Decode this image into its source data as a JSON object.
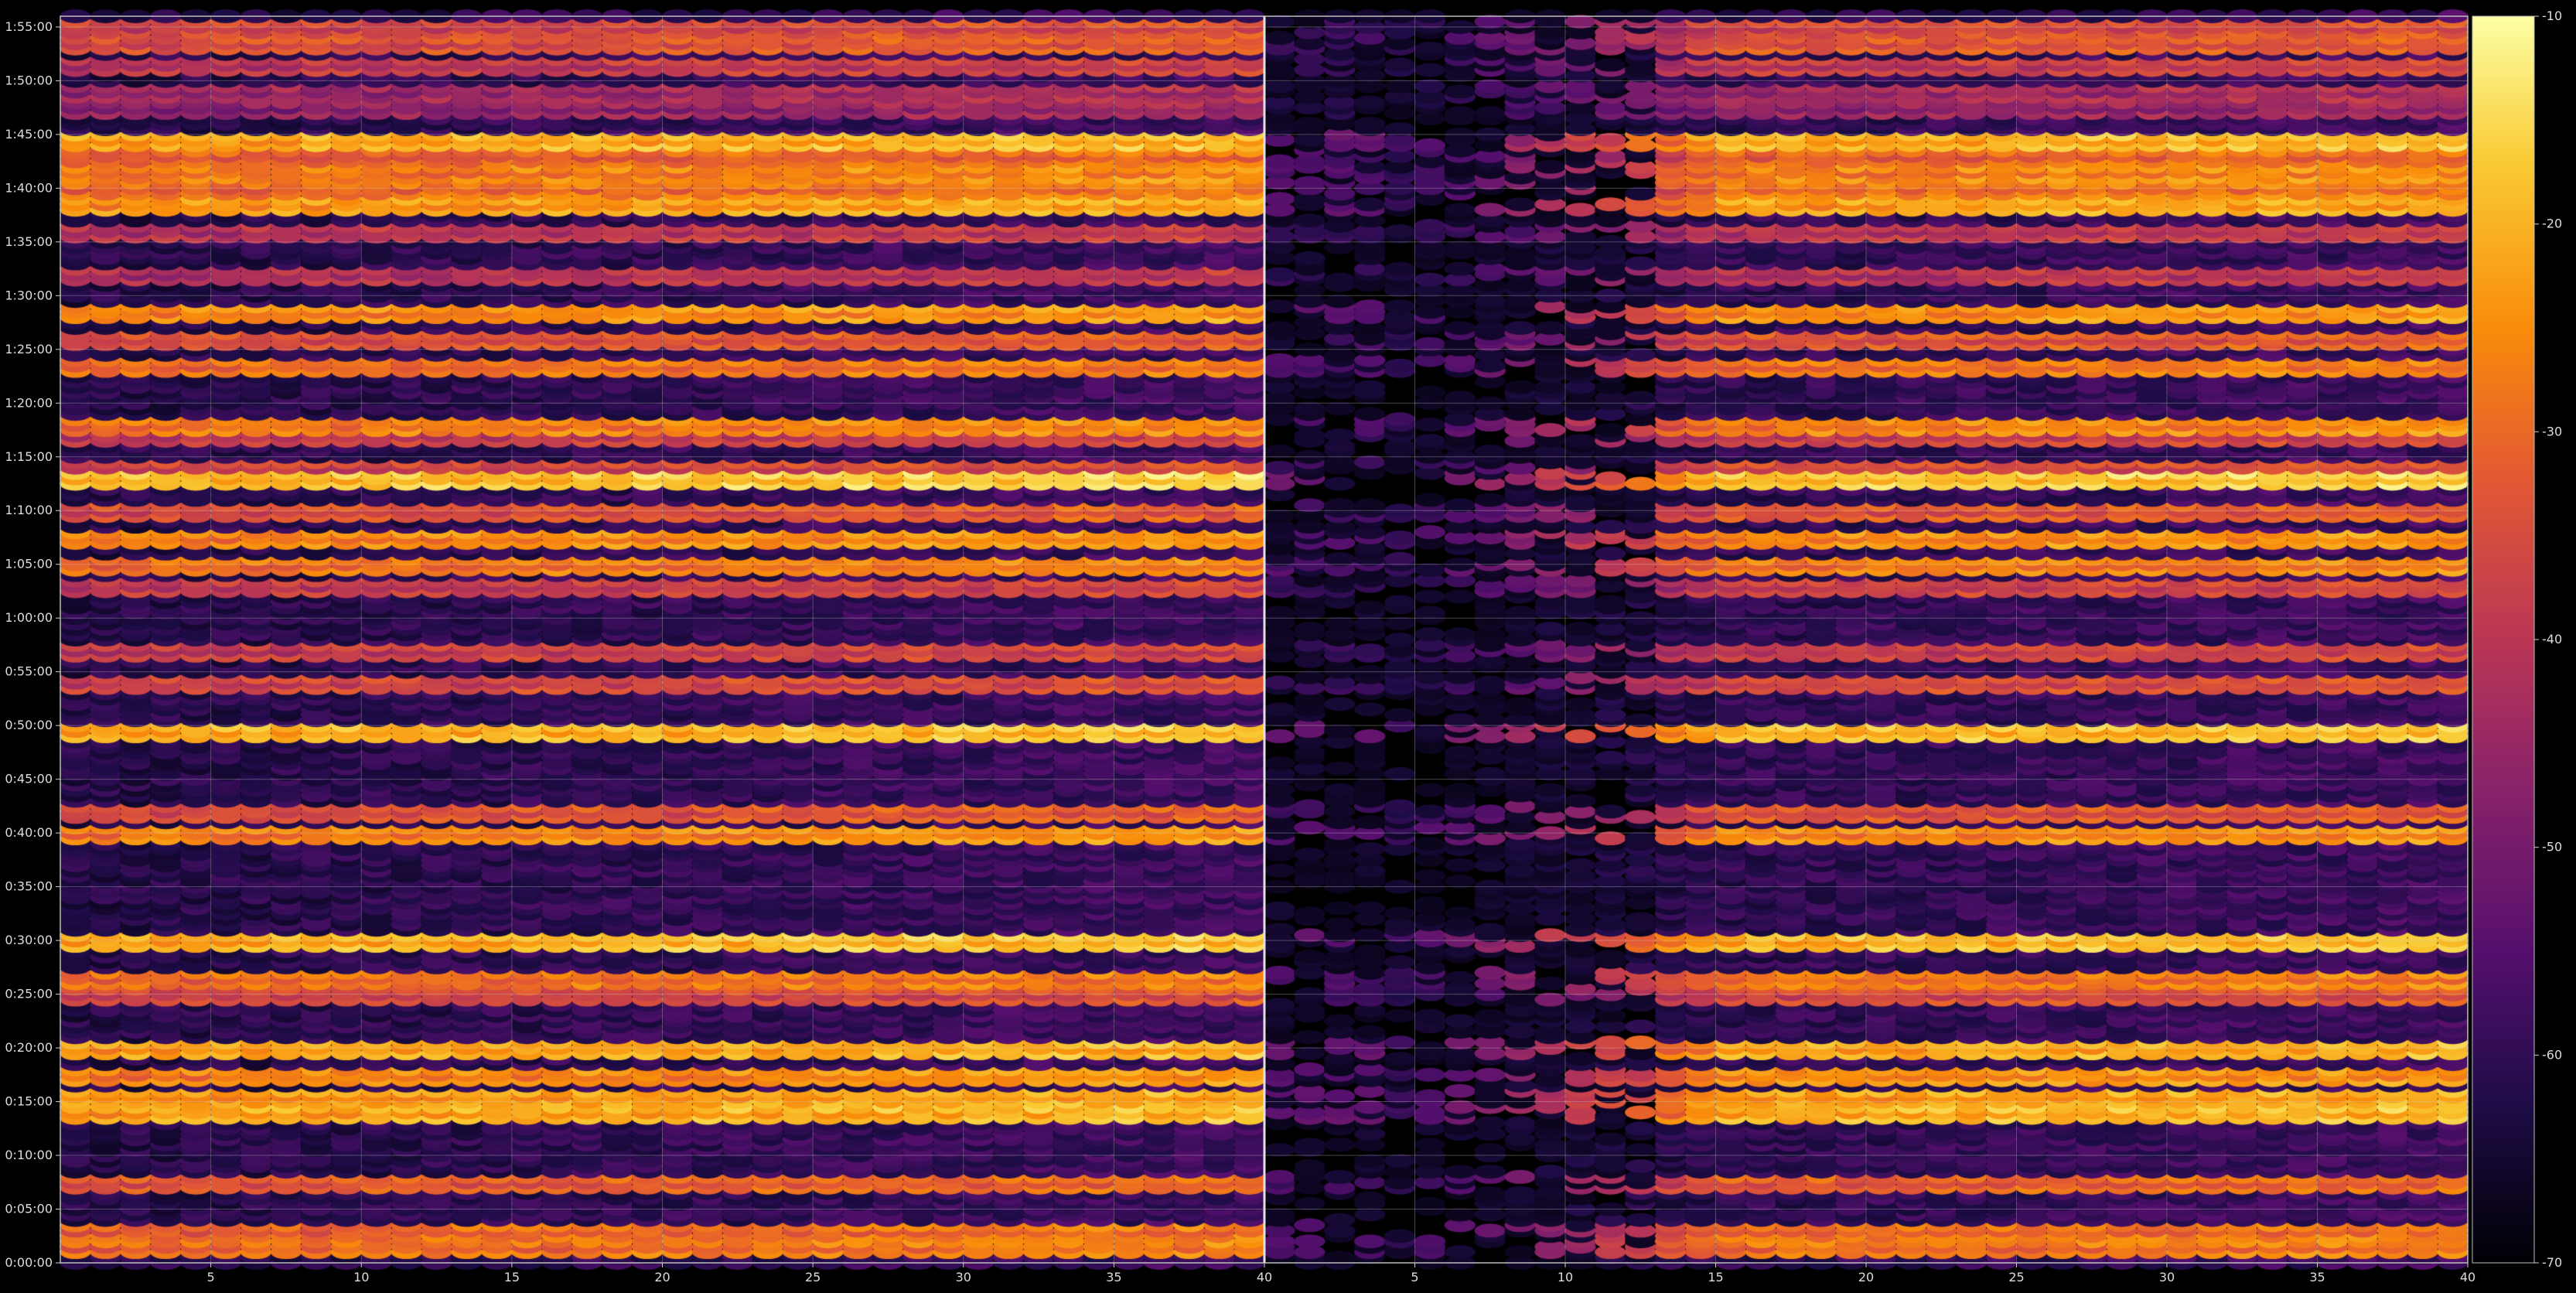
{
  "chart_data": {
    "type": "heatmap",
    "title": "",
    "xlabel": "",
    "ylabel": "",
    "colormap": "inferno",
    "grid": true,
    "panels": [
      {
        "name": "",
        "x_range": [
          1,
          40
        ],
        "x_ticks": [
          5,
          10,
          15,
          20,
          25,
          30,
          35,
          40
        ],
        "x_tick_labels": [
          "5",
          "10",
          "15",
          "20",
          "25",
          "30",
          "35",
          "40"
        ]
      },
      {
        "name": "",
        "x_range": [
          1,
          40
        ],
        "x_ticks": [
          5,
          10,
          15,
          20,
          25,
          30,
          35,
          40
        ],
        "x_tick_labels": [
          "5",
          "10",
          "15",
          "20",
          "25",
          "30",
          "35",
          "40"
        ],
        "note_left_columns_attenuated": true
      }
    ],
    "y_range_minutes": [
      0,
      116
    ],
    "y_ticks_minutes": [
      0,
      5,
      10,
      15,
      20,
      25,
      30,
      35,
      40,
      45,
      50,
      55,
      60,
      65,
      70,
      75,
      80,
      85,
      90,
      95,
      100,
      105,
      110,
      115
    ],
    "y_tick_labels": [
      "0:00:00",
      "0:05:00",
      "0:10:00",
      "0:15:00",
      "0:20:00",
      "0:25:00",
      "0:30:00",
      "0:35:00",
      "0:40:00",
      "0:45:00",
      "0:50:00",
      "0:55:00",
      "1:00:00",
      "1:05:00",
      "1:10:00",
      "1:15:00",
      "1:20:00",
      "1:25:00",
      "1:30:00",
      "1:35:00",
      "1:40:00",
      "1:45:00",
      "1:50:00",
      "1:55:00"
    ],
    "colorbar": {
      "range": [
        -70,
        -10
      ],
      "ticks": [
        -70,
        -60,
        -50,
        -40,
        -30,
        -20,
        -10
      ],
      "tick_labels": [
        "-70",
        "-60",
        "-50",
        "-40",
        "-30",
        "-20",
        "-10"
      ]
    },
    "bright_bands_minutes": [
      {
        "t": 1.5,
        "level": -33
      },
      {
        "t": 3.0,
        "level": -34
      },
      {
        "t": 7.5,
        "level": -36
      },
      {
        "t": 14.0,
        "level": -25
      },
      {
        "t": 15.5,
        "level": -27
      },
      {
        "t": 17.5,
        "level": -30
      },
      {
        "t": 20.0,
        "level": -26
      },
      {
        "t": 25.0,
        "level": -40
      },
      {
        "t": 26.5,
        "level": -33
      },
      {
        "t": 30.0,
        "level": -24
      },
      {
        "t": 40.0,
        "level": -30
      },
      {
        "t": 42.0,
        "level": -38
      },
      {
        "t": 49.5,
        "level": -24
      },
      {
        "t": 54.0,
        "level": -40
      },
      {
        "t": 57.0,
        "level": -42
      },
      {
        "t": 63.0,
        "level": -42
      },
      {
        "t": 65.0,
        "level": -32
      },
      {
        "t": 67.5,
        "level": -30
      },
      {
        "t": 70.0,
        "level": -38
      },
      {
        "t": 73.0,
        "level": -22
      },
      {
        "t": 74.0,
        "level": -40
      },
      {
        "t": 77.0,
        "level": -42
      },
      {
        "t": 78.0,
        "level": -31
      },
      {
        "t": 83.5,
        "level": -33
      },
      {
        "t": 86.0,
        "level": -38
      },
      {
        "t": 88.5,
        "level": -29
      },
      {
        "t": 92.0,
        "level": -45
      },
      {
        "t": 96.0,
        "level": -44
      },
      {
        "t": 98.5,
        "level": -27
      },
      {
        "t": 100.0,
        "level": -33
      },
      {
        "t": 101.5,
        "level": -31
      },
      {
        "t": 103.0,
        "level": -35
      },
      {
        "t": 104.5,
        "level": -25
      },
      {
        "t": 107.5,
        "level": -50
      },
      {
        "t": 109.0,
        "level": -48
      },
      {
        "t": 111.5,
        "level": -43
      },
      {
        "t": 113.5,
        "level": -38
      },
      {
        "t": 115.0,
        "level": -40
      }
    ]
  }
}
